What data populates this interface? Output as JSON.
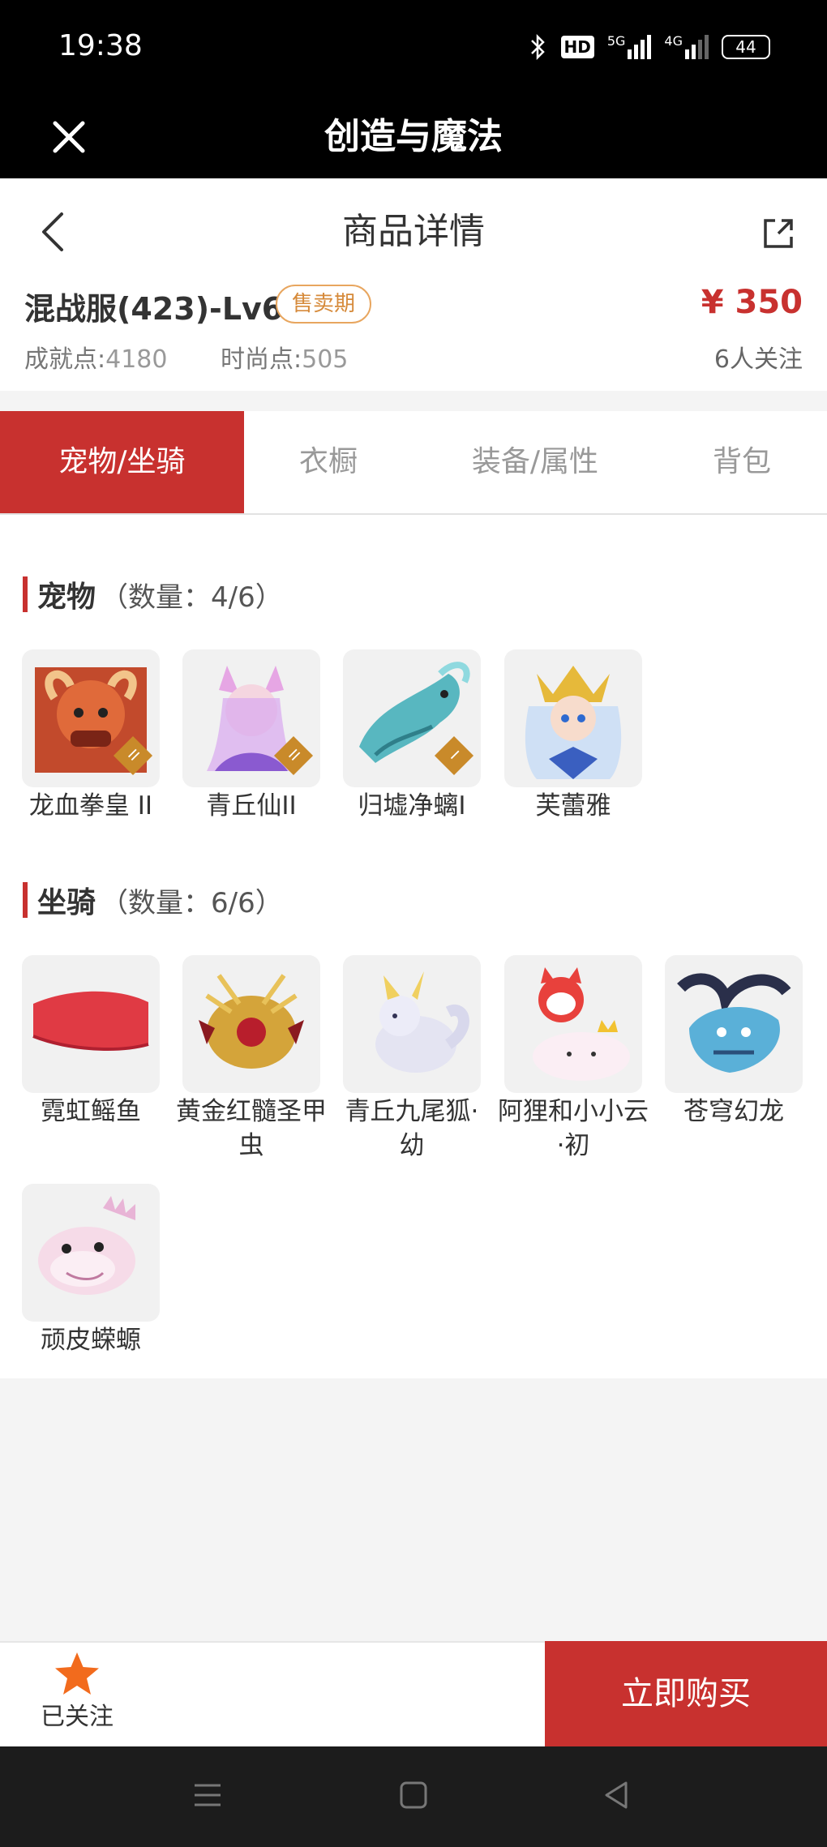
{
  "status_bar": {
    "time": "19:38",
    "hd_label": "HD",
    "net1": "5G",
    "net2": "4G",
    "battery": "44"
  },
  "app_bar": {
    "title": "创造与魔法"
  },
  "detail": {
    "title": "商品详情",
    "server_name": "混战服(423)-Lv69",
    "badge": "售卖期",
    "price": "¥ 350",
    "stat1_label": "成就点:",
    "stat1_value": "4180",
    "stat2_label": "时尚点:",
    "stat2_value": "505",
    "followers": "6人关注"
  },
  "tabs": [
    "宠物/坐骑",
    "衣橱",
    "装备/属性",
    "背包"
  ],
  "active_tab": 0,
  "pets": {
    "title": "宠物",
    "count": "（数量：4/6）",
    "items": [
      {
        "name": "龙血拳皇 II",
        "tier": "II"
      },
      {
        "name": "青丘仙II",
        "tier": "II"
      },
      {
        "name": "归墟净螭I",
        "tier": "I"
      },
      {
        "name": "芙蕾雅",
        "tier": ""
      }
    ]
  },
  "mounts": {
    "title": "坐骑",
    "count": "（数量：6/6）",
    "items": [
      {
        "name": "霓虹鳐鱼"
      },
      {
        "name": "黄金红髓圣甲虫"
      },
      {
        "name": "青丘九尾狐·幼"
      },
      {
        "name": "阿狸和小小云·初"
      },
      {
        "name": "苍穹幻龙"
      },
      {
        "name": "顽皮蝾螈"
      }
    ]
  },
  "bottom_bar": {
    "follow_label": "已关注",
    "buy_label": "立即购买"
  },
  "colors": {
    "accent": "#c8312f",
    "badge": "#e8a65f",
    "star": "#f26b1d"
  }
}
